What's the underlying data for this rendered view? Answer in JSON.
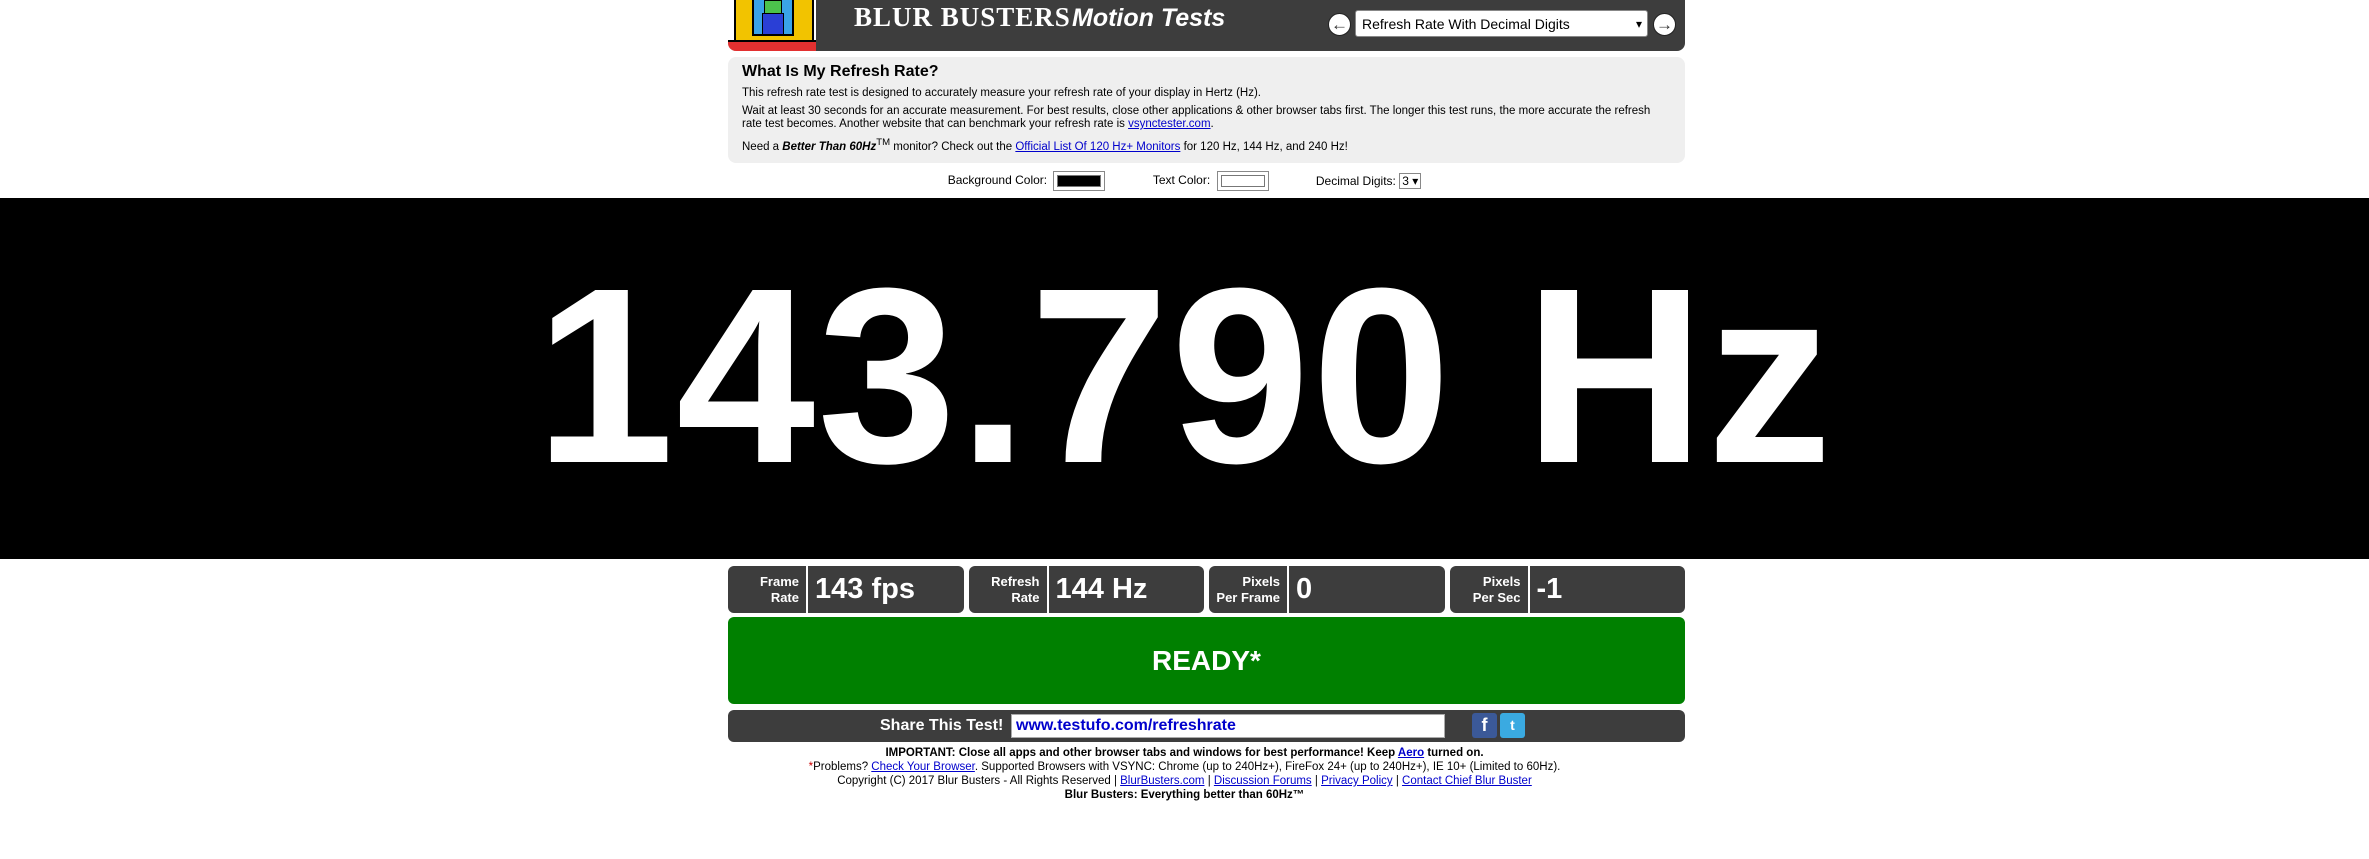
{
  "header": {
    "brand": "BLUR BUSTERS",
    "brand_sub": "Motion Tests",
    "prev_symbol": "←",
    "next_symbol": "→",
    "selected_test": "Refresh Rate With Decimal Digits"
  },
  "info": {
    "title": "What Is My Refresh Rate?",
    "p1": "This refresh rate test is designed to accurately measure your refresh rate of your display in Hertz (Hz).",
    "p2_text": "Wait at least 30 seconds for an accurate measurement. For best results, close other applications & other browser tabs first. The longer this test runs, the more accurate the refresh rate test becomes. Another website that can benchmark your refresh rate is ",
    "p2_link": "vsynctester.com",
    "p3_a": "Need a ",
    "p3_em": "Better Than 60Hz",
    "p3_tm": "TM",
    "p3_b": " monitor? Check out the ",
    "p3_link": "Official List Of 120 Hz+ Monitors",
    "p3_c": " for 120 Hz, 144 Hz, and 240 Hz!"
  },
  "options": {
    "bg_label": "Background Color:",
    "bg_color": "#000000",
    "text_label": "Text Color:",
    "text_color": "#ffffff",
    "digits_label": "Decimal Digits:",
    "digits_value": "3"
  },
  "display": {
    "value": "143.790 Hz"
  },
  "stats": [
    {
      "label_1": "Frame",
      "label_2": "Rate",
      "value": "143 fps"
    },
    {
      "label_1": "Refresh",
      "label_2": "Rate",
      "value": "144 Hz"
    },
    {
      "label_1": "Pixels",
      "label_2": "Per Frame",
      "value": "0"
    },
    {
      "label_1": "Pixels",
      "label_2": "Per Sec",
      "value": "-1"
    }
  ],
  "status": {
    "ready": "READY*"
  },
  "share": {
    "label": "Share This Test!",
    "url": "www.testufo.com/refreshrate",
    "facebook_glyph": "f",
    "twitter_glyph": "t"
  },
  "footer": {
    "line1_a": "IMPORTANT: Close all apps and other browser tabs and windows for best performance! Keep ",
    "line1_link": "Aero",
    "line1_b": " turned on.",
    "line2_star": "*",
    "line2_a": "Problems? ",
    "line2_link": "Check Your Browser",
    "line2_b": ". Supported Browsers with VSYNC: Chrome (up to 240Hz+), FireFox 24+ (up to 240Hz+), IE 10+ (Limited to 60Hz).",
    "line3_a": "Copyright (C) 2017 Blur Busters - All Rights Reserved | ",
    "line3_link1": "BlurBusters.com",
    "sep": " | ",
    "line3_link2": "Discussion Forums",
    "line3_link3": "Privacy Policy",
    "line3_link4": "Contact Chief Blur Buster",
    "line4": "Blur Busters: Everything better than 60Hz™"
  }
}
